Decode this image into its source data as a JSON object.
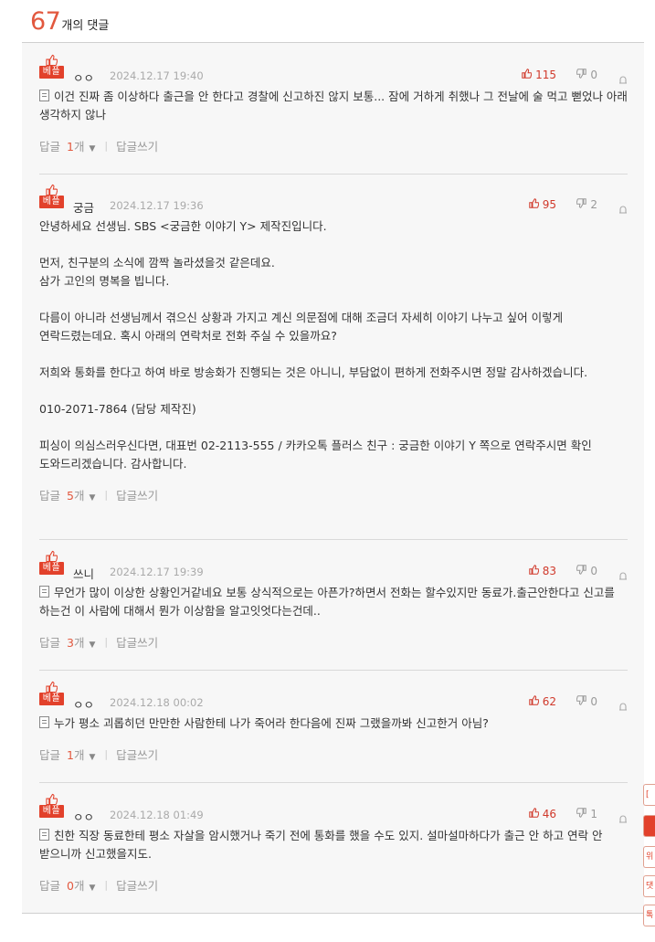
{
  "header": {
    "count": "67",
    "label": "개의 댓글"
  },
  "best_label": "베플",
  "reply_label": "답글",
  "reply_unit": "개",
  "write_reply_label": "답글쓰기",
  "comments": [
    {
      "author": "ㅇㅇ",
      "date": "2024.12.17 19:40",
      "likes": "115",
      "dislikes": "0",
      "lines": [
        "이건 진짜 좀 이상하다 출근을 안 한다고 경찰에 신고하진 않지 보통... 잠에 거하게 취했나 그 전날에 술 먹고 뻗었나 아래 생각하지 않나"
      ],
      "replies": "1"
    },
    {
      "author": "궁금",
      "date": "2024.12.17 19:36",
      "likes": "95",
      "dislikes": "2",
      "lines": [
        "안녕하세요 선생님. SBS <궁금한 이야기 Y> 제작진입니다.",
        "",
        "먼저, 친구분의 소식에 깜짝 놀라셨을것 같은데요.",
        "삼가 고인의 명복을 빕니다.",
        "",
        "다름이 아니라 선생님께서 겪으신 상황과 가지고 계신 의문점에 대해 조금더 자세히 이야기 나누고 싶어 이렇게 연락드렸는데요. 혹시 아래의 연락처로 전화 주실 수 있을까요?",
        "",
        "저희와 통화를 한다고 하여 바로 방송화가 진행되는 것은 아니니, 부담없이 편하게 전화주시면 정말 감사하겠습니다.",
        "",
        "010-2071-7864 (담당 제작진)",
        "",
        "피싱이 의심스러우신다면, 대표번 02-2113-555 / 카카오톡 플러스 친구 : 궁금한 이야기 Y 쪽으로 연락주시면 확인 도와드리겠습니다. 감사합니다."
      ],
      "replies": "5"
    },
    {
      "author": "쓰니",
      "date": "2024.12.17 19:39",
      "likes": "83",
      "dislikes": "0",
      "lines": [
        "무언가 많이 이상한 상황인거같네요 보통 상식적으로는 아픈가?하면서 전화는 할수있지만 동료가.출근안한다고 신고를 하는건 이 사람에 대해서 뭔가 이상함을 알고잇엇다는건데.."
      ],
      "replies": "3"
    },
    {
      "author": "ㅇㅇ",
      "date": "2024.12.18 00:02",
      "likes": "62",
      "dislikes": "0",
      "lines": [
        "누가 평소 괴롭히던 만만한 사람한테 나가 죽어라 한다음에 진짜 그랬을까봐 신고한거 아님?"
      ],
      "replies": "1"
    },
    {
      "author": "ㅇㅇ",
      "date": "2024.12.18 01:49",
      "likes": "46",
      "dislikes": "1",
      "lines": [
        "친한 직장 동료한테 평소 자살을 암시했거나 죽기 전에 통화를 했을 수도 있지. 설마설마하다가 출근 안 하고 연락 안 받으니까 신고했을지도."
      ],
      "replies": "0"
    }
  ],
  "side_tabs": [
    "[",
    "",
    "위",
    "댓",
    "톡"
  ]
}
